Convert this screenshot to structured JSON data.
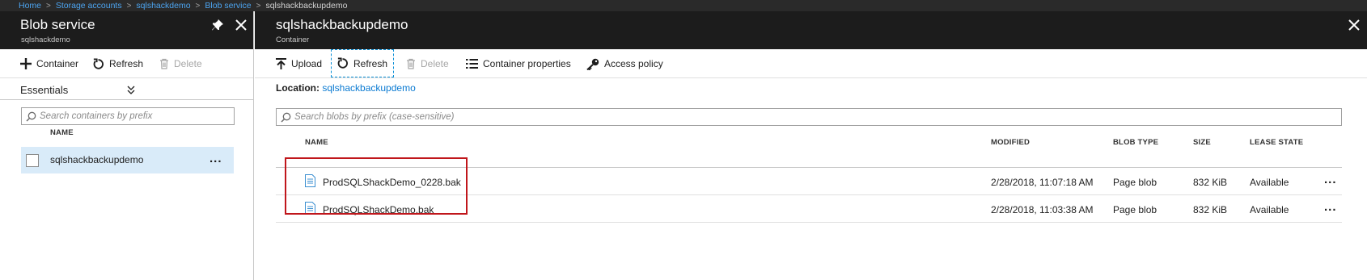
{
  "breadcrumb": {
    "items": [
      "Home",
      "Storage accounts",
      "sqlshackdemo",
      "Blob service"
    ],
    "current": "sqlshackbackupdemo"
  },
  "left_blade": {
    "title": "Blob service",
    "subtitle": "sqlshackdemo",
    "toolbar": {
      "container_label": "Container",
      "refresh_label": "Refresh",
      "delete_label": "Delete"
    },
    "essentials_label": "Essentials",
    "search": {
      "placeholder": "Search containers by prefix",
      "value": ""
    },
    "column_name": "NAME",
    "containers": [
      {
        "name": "sqlshackbackupdemo",
        "more": "..."
      }
    ]
  },
  "right_blade": {
    "title": "sqlshackbackupdemo",
    "subtitle": "Container",
    "toolbar": {
      "upload_label": "Upload",
      "refresh_label": "Refresh",
      "delete_label": "Delete",
      "properties_label": "Container properties",
      "access_label": "Access policy"
    },
    "location_label": "Location:",
    "location_value": "sqlshackbackupdemo",
    "search": {
      "placeholder": "Search blobs by prefix (case-sensitive)",
      "value": ""
    },
    "columns": {
      "name": "NAME",
      "modified": "MODIFIED",
      "blob_type": "BLOB TYPE",
      "size": "SIZE",
      "lease_state": "LEASE STATE"
    },
    "blobs": [
      {
        "name": "ProdSQLShackDemo_0228.bak",
        "modified": "2/28/2018, 11:07:18 AM",
        "blob_type": "Page blob",
        "size": "832 KiB",
        "lease_state": "Available",
        "more": "..."
      },
      {
        "name": "ProdSQLShackDemo.bak",
        "modified": "2/28/2018, 11:03:38 AM",
        "blob_type": "Page blob",
        "size": "832 KiB",
        "lease_state": "Available",
        "more": "..."
      }
    ]
  },
  "colors": {
    "header_bg": "#1c1c1c",
    "breadcrumb_bg": "#2a2a2a",
    "link": "#0a7ad2",
    "selected_row": "#d9ebf9",
    "highlight_border": "#c0161b",
    "focus_outline": "#0a8fd6"
  },
  "icons": [
    "pin-icon",
    "close-icon",
    "plus-icon",
    "refresh-icon",
    "trash-icon",
    "chevron-double-down-icon",
    "search-icon",
    "upload-icon",
    "list-icon",
    "key-icon",
    "file-icon"
  ]
}
